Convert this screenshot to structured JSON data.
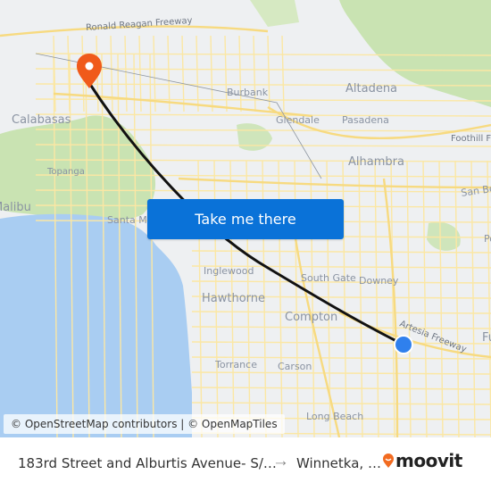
{
  "map": {
    "places": [
      {
        "name": "Calabasas",
        "size": "lg"
      },
      {
        "name": "Topanga",
        "size": "sm"
      },
      {
        "name": "Malibu",
        "size": "lg"
      },
      {
        "name": "Santa Monica",
        "size": "md"
      },
      {
        "name": "Burbank",
        "size": "md"
      },
      {
        "name": "Glendale",
        "size": "md"
      },
      {
        "name": "Altadena",
        "size": "lg"
      },
      {
        "name": "Pasadena",
        "size": "md"
      },
      {
        "name": "Alhambra",
        "size": "lg"
      },
      {
        "name": "San Bernardino",
        "size": "md"
      },
      {
        "name": "Pomona",
        "size": "md"
      },
      {
        "name": "Inglewood",
        "size": "md"
      },
      {
        "name": "Hawthorne",
        "size": "lg"
      },
      {
        "name": "South Gate",
        "size": "md"
      },
      {
        "name": "Downey",
        "size": "md"
      },
      {
        "name": "Compton",
        "size": "lg"
      },
      {
        "name": "Torrance",
        "size": "md"
      },
      {
        "name": "Carson",
        "size": "md"
      },
      {
        "name": "Long Beach",
        "size": "md"
      },
      {
        "name": "Fullerton",
        "size": "lg"
      }
    ],
    "roads": [
      {
        "name": "Ronald Reagan Freeway"
      },
      {
        "name": "Foothill Freeway"
      },
      {
        "name": "Artesia Freeway"
      }
    ],
    "origin_marker": {
      "label": "origin",
      "color": "#2f80ed"
    },
    "destination_marker": {
      "label": "destination",
      "color": "#f05a1a"
    },
    "route_color": "#111111",
    "water_color": "#a9cdf2",
    "park_color": "#c9e3b2"
  },
  "cta": {
    "label": "Take me there"
  },
  "attribution": "© OpenStreetMap contributors | © OpenMapTiles",
  "footer": {
    "origin": "183rd Street and Alburtis Avenue- S/…",
    "arrow": "→",
    "destination": "Winnetka, …",
    "brand": "moovit",
    "brand_color": "#f26b21"
  }
}
